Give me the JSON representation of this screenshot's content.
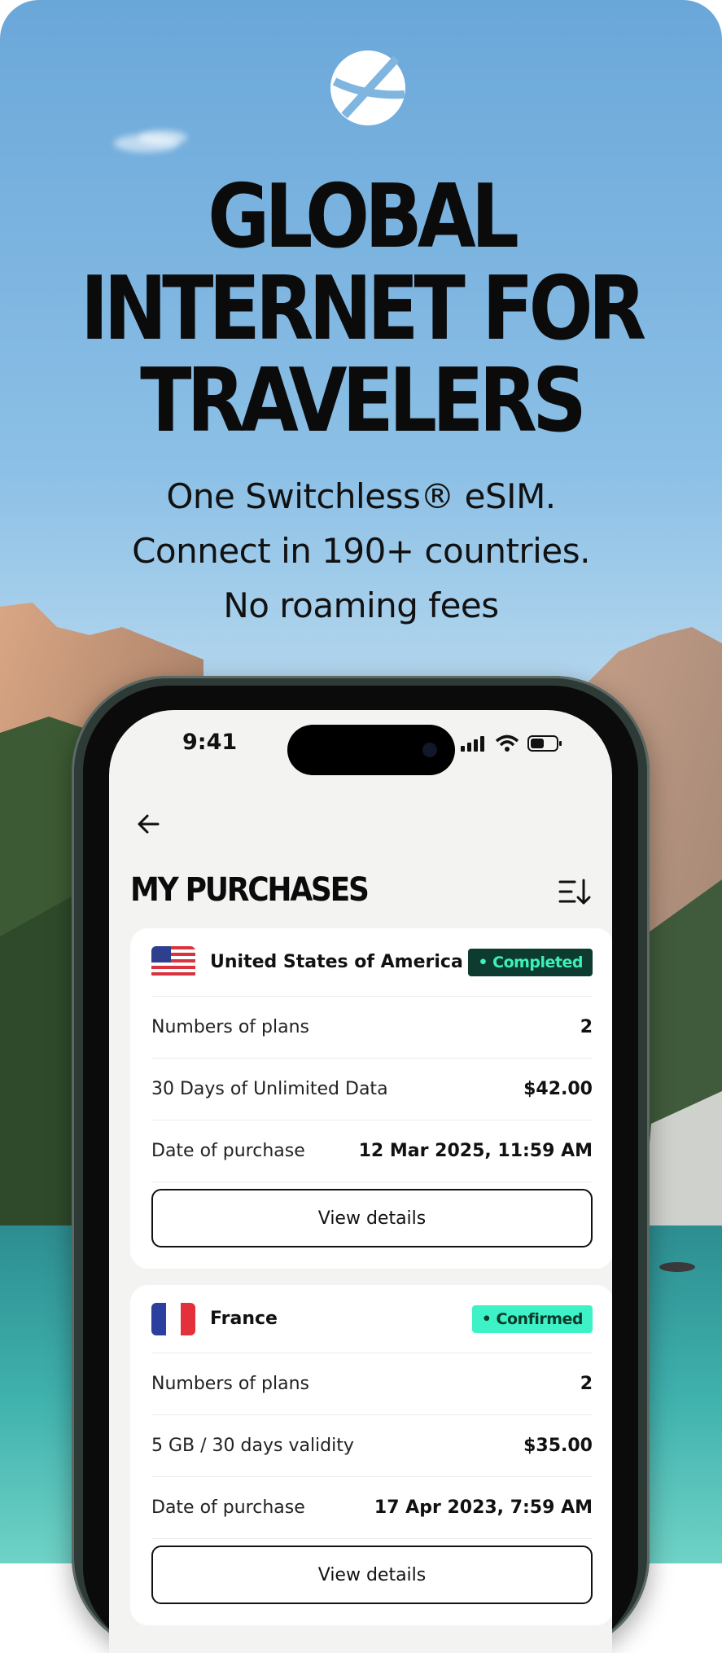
{
  "promo": {
    "headline": [
      "GLOBAL",
      "INTERNET FOR",
      "TRAVELERS"
    ],
    "subtitle": [
      "One Switchless® eSIM.",
      "Connect in 190+ countries.",
      "No roaming fees"
    ]
  },
  "status_bar": {
    "time": "9:41"
  },
  "page": {
    "title": "MY PURCHASES"
  },
  "purchases": [
    {
      "country": "United States of America",
      "flag": "us-flag-icon",
      "status": "• Completed",
      "rows": [
        {
          "label": "Numbers of plans",
          "value": "2"
        },
        {
          "label": "30 Days of Unlimited Data",
          "value": "$42.00"
        },
        {
          "label": "Date of purchase",
          "value": "12 Mar 2025, 11:59 AM"
        }
      ],
      "button": "View details"
    },
    {
      "country": "France",
      "flag": "fr-flag-icon",
      "status": "• Confirmed",
      "rows": [
        {
          "label": "Numbers of plans",
          "value": "2"
        },
        {
          "label": "5 GB / 30 days validity",
          "value": "$35.00"
        },
        {
          "label": "Date of purchase",
          "value": "17 Apr 2023, 7:59 AM"
        }
      ],
      "button": "View details"
    }
  ],
  "colors": {
    "completed_bg": "#0e3b2f",
    "confirmed_bg": "#3df2c6",
    "screen_bg": "#f3f3f1"
  }
}
